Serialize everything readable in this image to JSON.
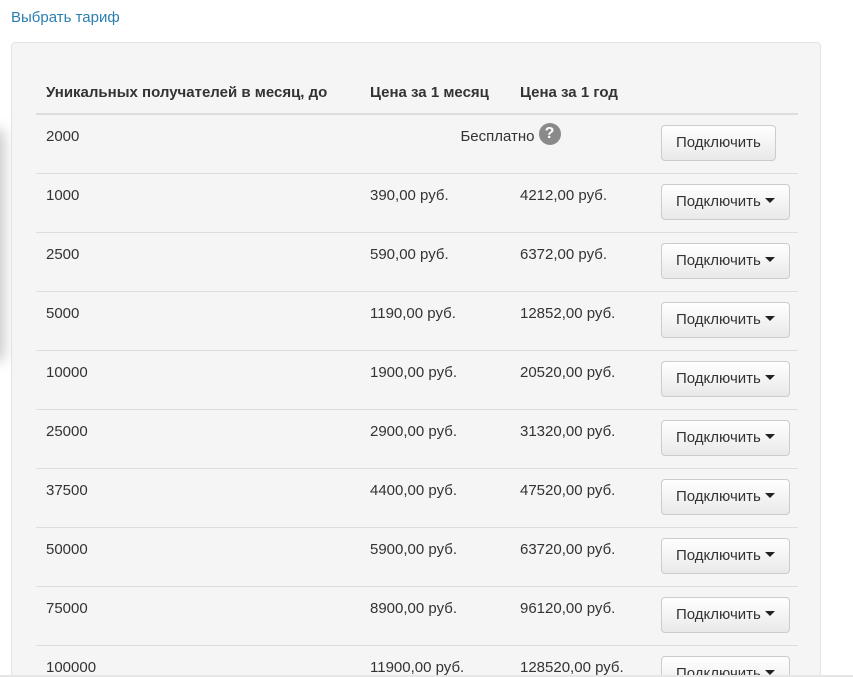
{
  "header": {
    "choose_tariff_link": "Выбрать тариф"
  },
  "table": {
    "columns": [
      "Уникальных получателей в месяц, до",
      "Цена за 1 месяц",
      "Цена за 1 год"
    ],
    "free_row": {
      "recipients": "2000",
      "price_label": "Бесплатно",
      "help_icon": "question-circle-icon",
      "button_label": "Подключить"
    },
    "rows": [
      {
        "recipients": "1000",
        "month": "390,00 руб.",
        "year": "4212,00 руб.",
        "button_label": "Подключить"
      },
      {
        "recipients": "2500",
        "month": "590,00 руб.",
        "year": "6372,00 руб.",
        "button_label": "Подключить"
      },
      {
        "recipients": "5000",
        "month": "1190,00 руб.",
        "year": "12852,00 руб.",
        "button_label": "Подключить"
      },
      {
        "recipients": "10000",
        "month": "1900,00 руб.",
        "year": "20520,00 руб.",
        "button_label": "Подключить"
      },
      {
        "recipients": "25000",
        "month": "2900,00 руб.",
        "year": "31320,00 руб.",
        "button_label": "Подключить"
      },
      {
        "recipients": "37500",
        "month": "4400,00 руб.",
        "year": "47520,00 руб.",
        "button_label": "Подключить"
      },
      {
        "recipients": "50000",
        "month": "5900,00 руб.",
        "year": "63720,00 руб.",
        "button_label": "Подключить"
      },
      {
        "recipients": "75000",
        "month": "8900,00 руб.",
        "year": "96120,00 руб.",
        "button_label": "Подключить"
      },
      {
        "recipients": "100000",
        "month": "11900,00 руб.",
        "year": "128520,00 руб.",
        "button_label": "Подключить"
      }
    ]
  },
  "colors": {
    "link": "#2a7fb0",
    "panel_background": "#f5f5f5",
    "help_icon": "#8a8a8a"
  }
}
